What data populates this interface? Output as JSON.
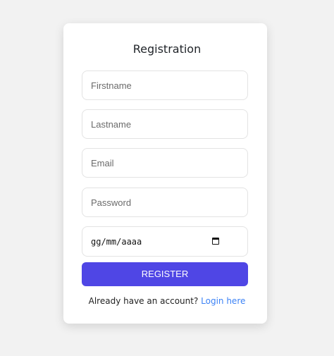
{
  "form": {
    "title": "Registration",
    "fields": [
      {
        "name": "firstname",
        "placeholder": "Firstname",
        "value": ""
      },
      {
        "name": "lastname",
        "placeholder": "Lastname",
        "value": ""
      },
      {
        "name": "email",
        "placeholder": "Email",
        "value": ""
      },
      {
        "name": "password",
        "placeholder": "Password",
        "value": ""
      }
    ],
    "date_placeholder": "gg/mm/aaaa",
    "submit_label": "REGISTER"
  },
  "footer": {
    "prompt": "Already have an account? ",
    "link_label": "Login here"
  },
  "icons": {
    "date": "calendar-icon"
  },
  "colors": {
    "background": "#f2f2f2",
    "card": "#ffffff",
    "primary": "#4f46e5",
    "link": "#3b82f6"
  }
}
